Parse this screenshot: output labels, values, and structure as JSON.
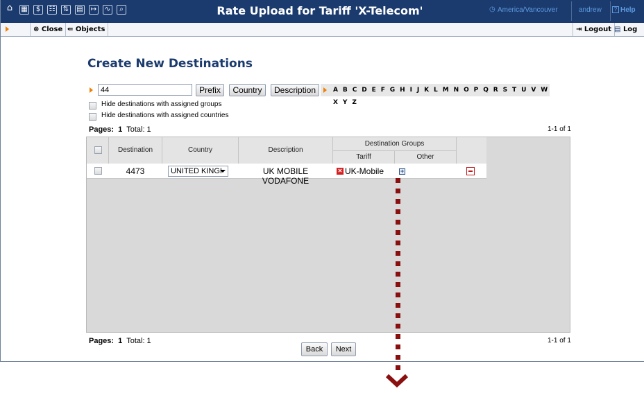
{
  "window": {
    "title": "Rate Upload for Tariff 'X-Telecom'",
    "timezone": "America/Vancouver",
    "user": "andrew",
    "help_label": "Help"
  },
  "toolbar": {
    "close_label": "Close",
    "objects_label": "Objects",
    "logout_label": "Logout",
    "log_label": "Log"
  },
  "main": {
    "heading": "Create New Destinations",
    "prefix_value": "44",
    "filter_buttons": [
      "Prefix",
      "Country",
      "Description"
    ],
    "alphabet": "A B C D E F G H I J K L M N O P Q R S T U V W X Y Z",
    "hide_groups_label": "Hide destinations with assigned groups",
    "hide_countries_label": "Hide destinations with assigned countries",
    "pages_label": "Pages:",
    "page_number": "1",
    "total_label": "Total: 1",
    "range": "1-1 of 1"
  },
  "table": {
    "headers": {
      "destination": "Destination",
      "country": "Country",
      "description": "Description",
      "groups": "Destination Groups",
      "tariff": "Tariff",
      "other": "Other"
    },
    "rows": [
      {
        "destination": "4473",
        "country": "UNITED KINGI",
        "description": "UK MOBILE VODAFONE",
        "tariff_group": "UK-Mobile"
      }
    ]
  },
  "footer": {
    "back_label": "Back",
    "next_label": "Next"
  },
  "icons": [
    "home-icon",
    "grid-icon",
    "dollar-icon",
    "people-icon",
    "transfer-icon",
    "table-icon",
    "export-icon",
    "chart-icon",
    "search-icon",
    "clock-icon",
    "help-icon",
    "close-icon",
    "objects-icon",
    "logout-icon",
    "log-icon",
    "remove-icon",
    "add-icon",
    "delete-row-icon",
    "chevron-down-icon"
  ],
  "colors": {
    "header_bg": "#1b3b6f",
    "accent_orange": "#f08000",
    "heading_blue": "#1b3b6f",
    "annotation_red": "#8a1010"
  }
}
